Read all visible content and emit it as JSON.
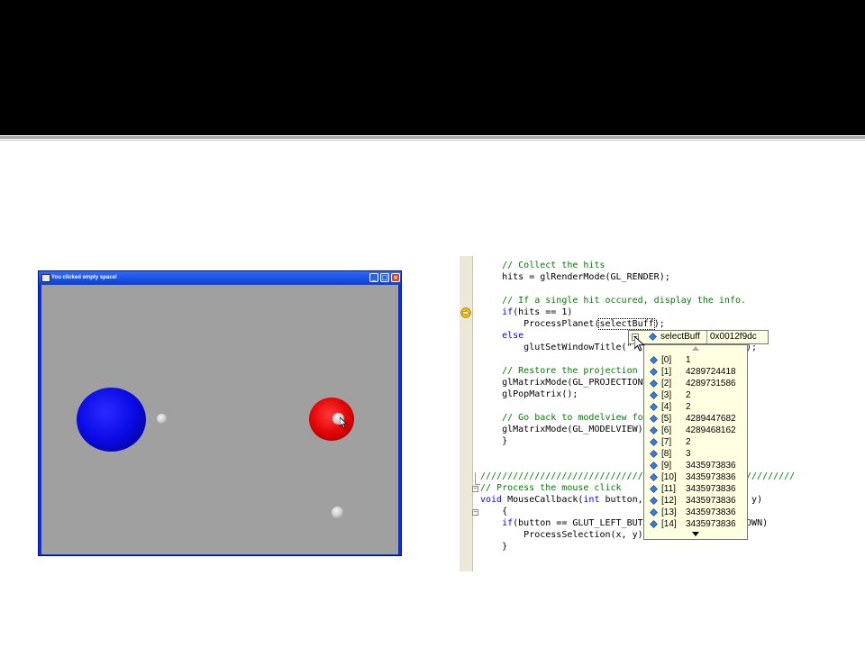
{
  "gl_window": {
    "title": "You clicked empty space!",
    "background_color": "#a0a0a0",
    "titlebar_color": "#0a3fd4",
    "controls": [
      "minimize-icon",
      "maximize-icon",
      "close-icon"
    ]
  },
  "editor": {
    "lines": [
      {
        "indent": "    ",
        "parts": [
          {
            "t": "// Collect the hits",
            "c": "cm"
          }
        ]
      },
      {
        "indent": "    ",
        "parts": [
          {
            "t": "hits = glRenderMode(GL_RENDER);",
            "c": ""
          }
        ]
      },
      {
        "indent": "",
        "parts": []
      },
      {
        "indent": "    ",
        "parts": [
          {
            "t": "// If a single hit occured, display the info.",
            "c": "cm"
          }
        ]
      },
      {
        "indent": "    ",
        "parts": [
          {
            "t": "if",
            "c": "kw"
          },
          {
            "t": "(hits == 1)",
            "c": ""
          }
        ]
      },
      {
        "indent": "        ",
        "parts": [
          {
            "t": "ProcessPlanet(",
            "c": ""
          },
          {
            "t": "selectBuff",
            "c": "",
            "id": "selectBuff"
          },
          {
            "t": ");",
            "c": ""
          }
        ]
      },
      {
        "indent": "    ",
        "parts": [
          {
            "t": "else",
            "c": "kw"
          }
        ]
      },
      {
        "indent": "        ",
        "parts": [
          {
            "t": "glutSetWindowTitle(\"",
            "c": ""
          },
          {
            "t": "                  ",
            "c": ""
          },
          {
            "t": "e!\");",
            "c": ""
          }
        ]
      },
      {
        "indent": "",
        "parts": []
      },
      {
        "indent": "    ",
        "parts": [
          {
            "t": "// Restore the projection",
            "c": "cm"
          }
        ]
      },
      {
        "indent": "    ",
        "parts": [
          {
            "t": "glMatrixMode(GL_PROJECTION",
            "c": ""
          }
        ]
      },
      {
        "indent": "    ",
        "parts": [
          {
            "t": "glPopMatrix();",
            "c": ""
          }
        ]
      },
      {
        "indent": "",
        "parts": []
      },
      {
        "indent": "    ",
        "parts": [
          {
            "t": "// Go back to modelview fo",
            "c": "cm"
          }
        ]
      },
      {
        "indent": "    ",
        "parts": [
          {
            "t": "glMatrixMode(GL_MODELVIEW)",
            "c": ""
          }
        ]
      },
      {
        "indent": "    ",
        "parts": [
          {
            "t": "}",
            "c": ""
          }
        ]
      },
      {
        "indent": "",
        "parts": []
      },
      {
        "indent": "",
        "parts": []
      },
      {
        "indent": "",
        "parts": [
          {
            "t": "//////////////////////////////",
            "c": "cm"
          },
          {
            "t": "                  ",
            "c": ""
          },
          {
            "t": "//////////",
            "c": "cm"
          }
        ]
      },
      {
        "indent": "",
        "parts": [
          {
            "t": "// Process the mouse click",
            "c": "cm"
          }
        ]
      },
      {
        "indent": "",
        "parts": [
          {
            "t": "void",
            "c": "kw"
          },
          {
            "t": " MouseCallback(",
            "c": ""
          },
          {
            "t": "int",
            "c": "kw"
          },
          {
            "t": " button,",
            "c": ""
          },
          {
            "t": "                ",
            "c": ""
          },
          {
            "t": "int",
            "c": "kw"
          },
          {
            "t": " y)",
            "c": ""
          }
        ]
      },
      {
        "indent": "    ",
        "parts": [
          {
            "t": "{",
            "c": ""
          }
        ]
      },
      {
        "indent": "    ",
        "parts": [
          {
            "t": "if",
            "c": "kw"
          },
          {
            "t": "(button == GLUT_LEFT_BUT",
            "c": ""
          },
          {
            "t": "                ",
            "c": ""
          },
          {
            "t": "T_DOWN)",
            "c": ""
          }
        ]
      },
      {
        "indent": "        ",
        "parts": [
          {
            "t": "ProcessSelection(x, y);",
            "c": ""
          }
        ]
      },
      {
        "indent": "    ",
        "parts": [
          {
            "t": "}",
            "c": ""
          }
        ]
      }
    ],
    "colors": {
      "comment": "#008000",
      "keyword": "#0000ff"
    },
    "gutter_icons": [
      "breakpoint-arrow-icon"
    ]
  },
  "watch": {
    "name": "selectBuff",
    "value": "0x0012f9dc",
    "rows": [
      {
        "index": "[0]",
        "value": "1"
      },
      {
        "index": "[1]",
        "value": "4289724418"
      },
      {
        "index": "[2]",
        "value": "4289731586"
      },
      {
        "index": "[3]",
        "value": "2"
      },
      {
        "index": "[4]",
        "value": "2"
      },
      {
        "index": "[5]",
        "value": "4289447682"
      },
      {
        "index": "[6]",
        "value": "4289468162"
      },
      {
        "index": "[7]",
        "value": "2"
      },
      {
        "index": "[8]",
        "value": "3"
      },
      {
        "index": "[9]",
        "value": "3435973836"
      },
      {
        "index": "[10]",
        "value": "3435973836"
      },
      {
        "index": "[11]",
        "value": "3435973836"
      },
      {
        "index": "[12]",
        "value": "3435973836"
      },
      {
        "index": "[13]",
        "value": "3435973836"
      },
      {
        "index": "[14]",
        "value": "3435973836"
      }
    ]
  }
}
